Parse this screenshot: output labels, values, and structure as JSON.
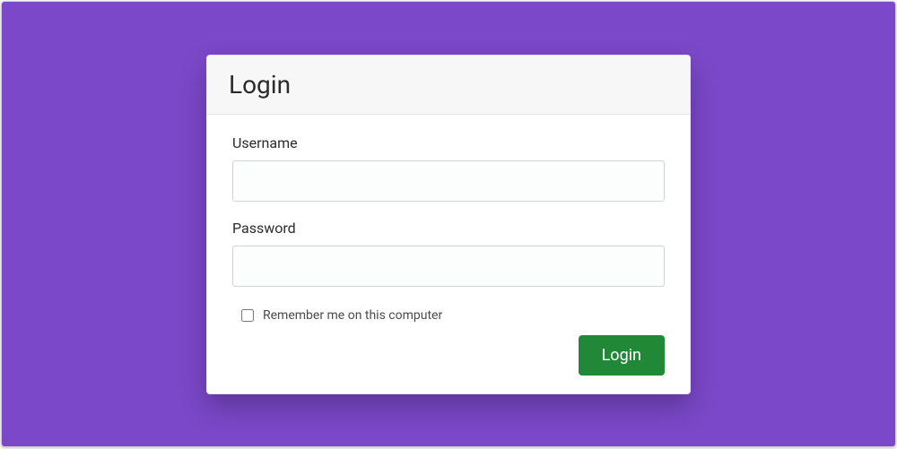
{
  "colors": {
    "page_bg": "#7b48c9",
    "card_bg": "#ffffff",
    "header_bg": "#f7f7f7",
    "button_bg": "#218838",
    "button_text": "#ffffff",
    "input_border": "#cdd6d6"
  },
  "header": {
    "title": "Login"
  },
  "form": {
    "username": {
      "label": "Username",
      "value": "",
      "placeholder": ""
    },
    "password": {
      "label": "Password",
      "value": "",
      "placeholder": ""
    },
    "remember": {
      "label": "Remember me on this computer",
      "checked": false
    },
    "submit": {
      "label": "Login"
    }
  }
}
